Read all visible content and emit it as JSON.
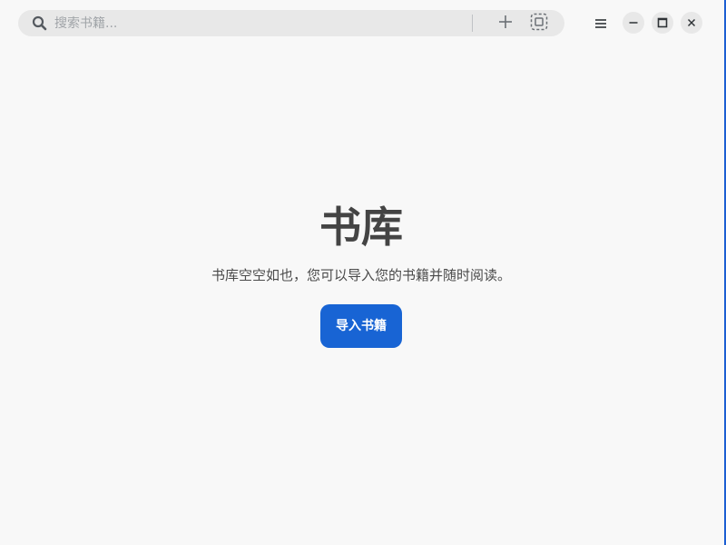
{
  "header": {
    "search": {
      "placeholder": "搜索书籍...",
      "value": ""
    },
    "icons": {
      "search": "search-icon",
      "add": "plus-icon",
      "select": "selection-icon",
      "menu": "hamburger-menu-icon",
      "minimize": "minimize-icon",
      "maximize": "maximize-icon",
      "close": "close-icon"
    }
  },
  "empty_state": {
    "title": "书库",
    "message": "书库空空如也，您可以导入您的书籍并随时阅读。",
    "import_button_label": "导入书籍"
  },
  "colors": {
    "background": "#f8f8f8",
    "accent": "#1864d4",
    "title": "#444444",
    "search_bg": "#e8e8e8"
  }
}
